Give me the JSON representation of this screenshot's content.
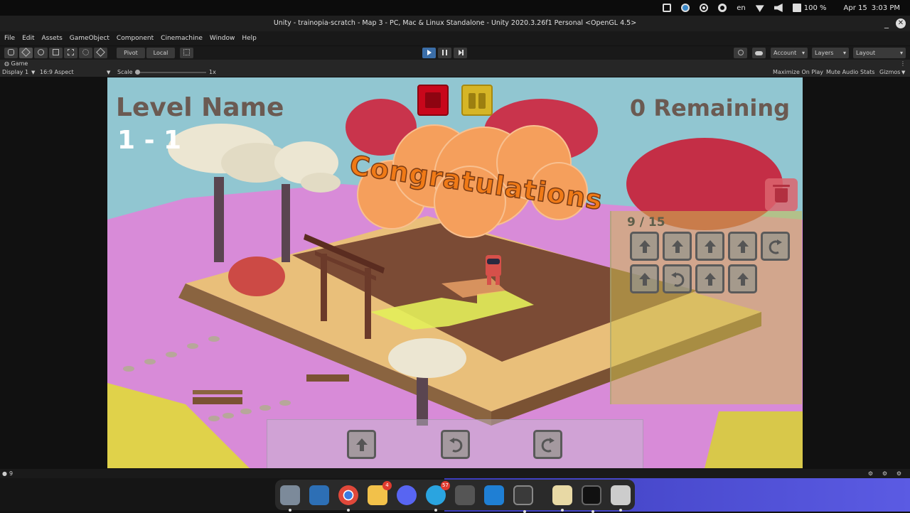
{
  "system_bar": {
    "language": "en",
    "battery": "100 %",
    "date": "Apr 15",
    "time": "3:03 PM"
  },
  "window": {
    "title": "Unity - trainopia-scratch - Map 3 - PC, Mac & Linux Standalone - Unity 2020.3.26f1 Personal <OpenGL 4.5>",
    "minimize": "_",
    "maximize": "□",
    "close": "✕"
  },
  "menu": [
    "File",
    "Edit",
    "Assets",
    "GameObject",
    "Component",
    "Cinemachine",
    "Window",
    "Help"
  ],
  "toolbar": {
    "pivot": "Pivot",
    "local": "Local",
    "account": "Account",
    "layers": "Layers",
    "layout": "Layout"
  },
  "game_view": {
    "tab": "Game",
    "display": "Display 1",
    "aspect": "16:9 Aspect",
    "scale_label": "Scale",
    "scale_value": "1x",
    "maximize_on_play": "Maximize On Play",
    "mute_audio": "Mute Audio",
    "stats": "Stats",
    "gizmos": "Gizmos"
  },
  "game": {
    "level_name": "Level Name",
    "level_number": "1 - 1",
    "remaining": "0 Remaining",
    "congratulations": "Congratulations",
    "block_count": "9 / 15",
    "program_blocks": [
      "arrow-up",
      "arrow-up",
      "arrow-up",
      "arrow-up",
      "turn-right",
      "arrow-up",
      "turn-left",
      "arrow-up",
      "arrow-up"
    ],
    "palette_blocks": [
      "arrow-up",
      "turn-left",
      "turn-right"
    ]
  },
  "status_bar": {
    "message_count": "9"
  },
  "dock": {
    "mail_badge": "4",
    "telegram_badge": "57",
    "apps": [
      "files",
      "app-grid",
      "chrome",
      "mail",
      "discord",
      "telegram",
      "unity-hub",
      "vscode",
      "system-monitor",
      "text-editor",
      "unity",
      "disk-manager"
    ]
  },
  "colors": {
    "stop_button": "#c8071b",
    "pause_button": "#d6b526",
    "congrats_text": "#f07a16",
    "sky": "#91c6d1",
    "ground": "#d67bd6"
  }
}
